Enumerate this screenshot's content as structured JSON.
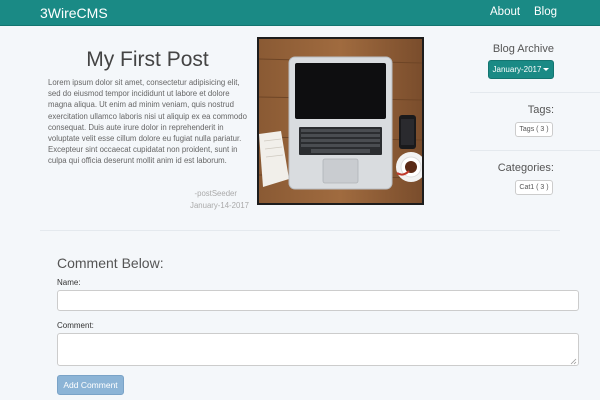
{
  "nav": {
    "brand": "3WireCMS",
    "links": [
      "About",
      "Blog"
    ]
  },
  "post": {
    "title": "My First Post",
    "body": "Lorem ipsum dolor sit amet, consectetur adipisicing elit, sed do eiusmod tempor incididunt ut labore et dolore magna aliqua. Ut enim ad minim veniam, quis nostrud exercitation ullamco laboris nisi ut aliquip ex ea commodo consequat. Duis aute irure dolor in reprehenderit in voluptate velit esse cillum dolore eu fugiat nulla pariatur. Excepteur sint occaecat cupidatat non proident, sunt in culpa qui officia deserunt mollit anim id est laborum.",
    "author": "-postSeeder",
    "date": "January-14-2017"
  },
  "sidebar": {
    "archive_heading": "Blog Archive",
    "archive_button": "January-2017",
    "tags_heading": "Tags:",
    "tags_pill": "Tags ( 3 )",
    "categories_heading": "Categories:",
    "categories_pill": "Cat1 ( 3 )"
  },
  "comment_form": {
    "heading": "Comment Below:",
    "name_label": "Name:",
    "comment_label": "Comment:",
    "submit_label": "Add Comment"
  },
  "colors": {
    "navbar": "#1a8a85",
    "page_background": "#f4f7fa",
    "submit_button": "#8cb4d6"
  }
}
